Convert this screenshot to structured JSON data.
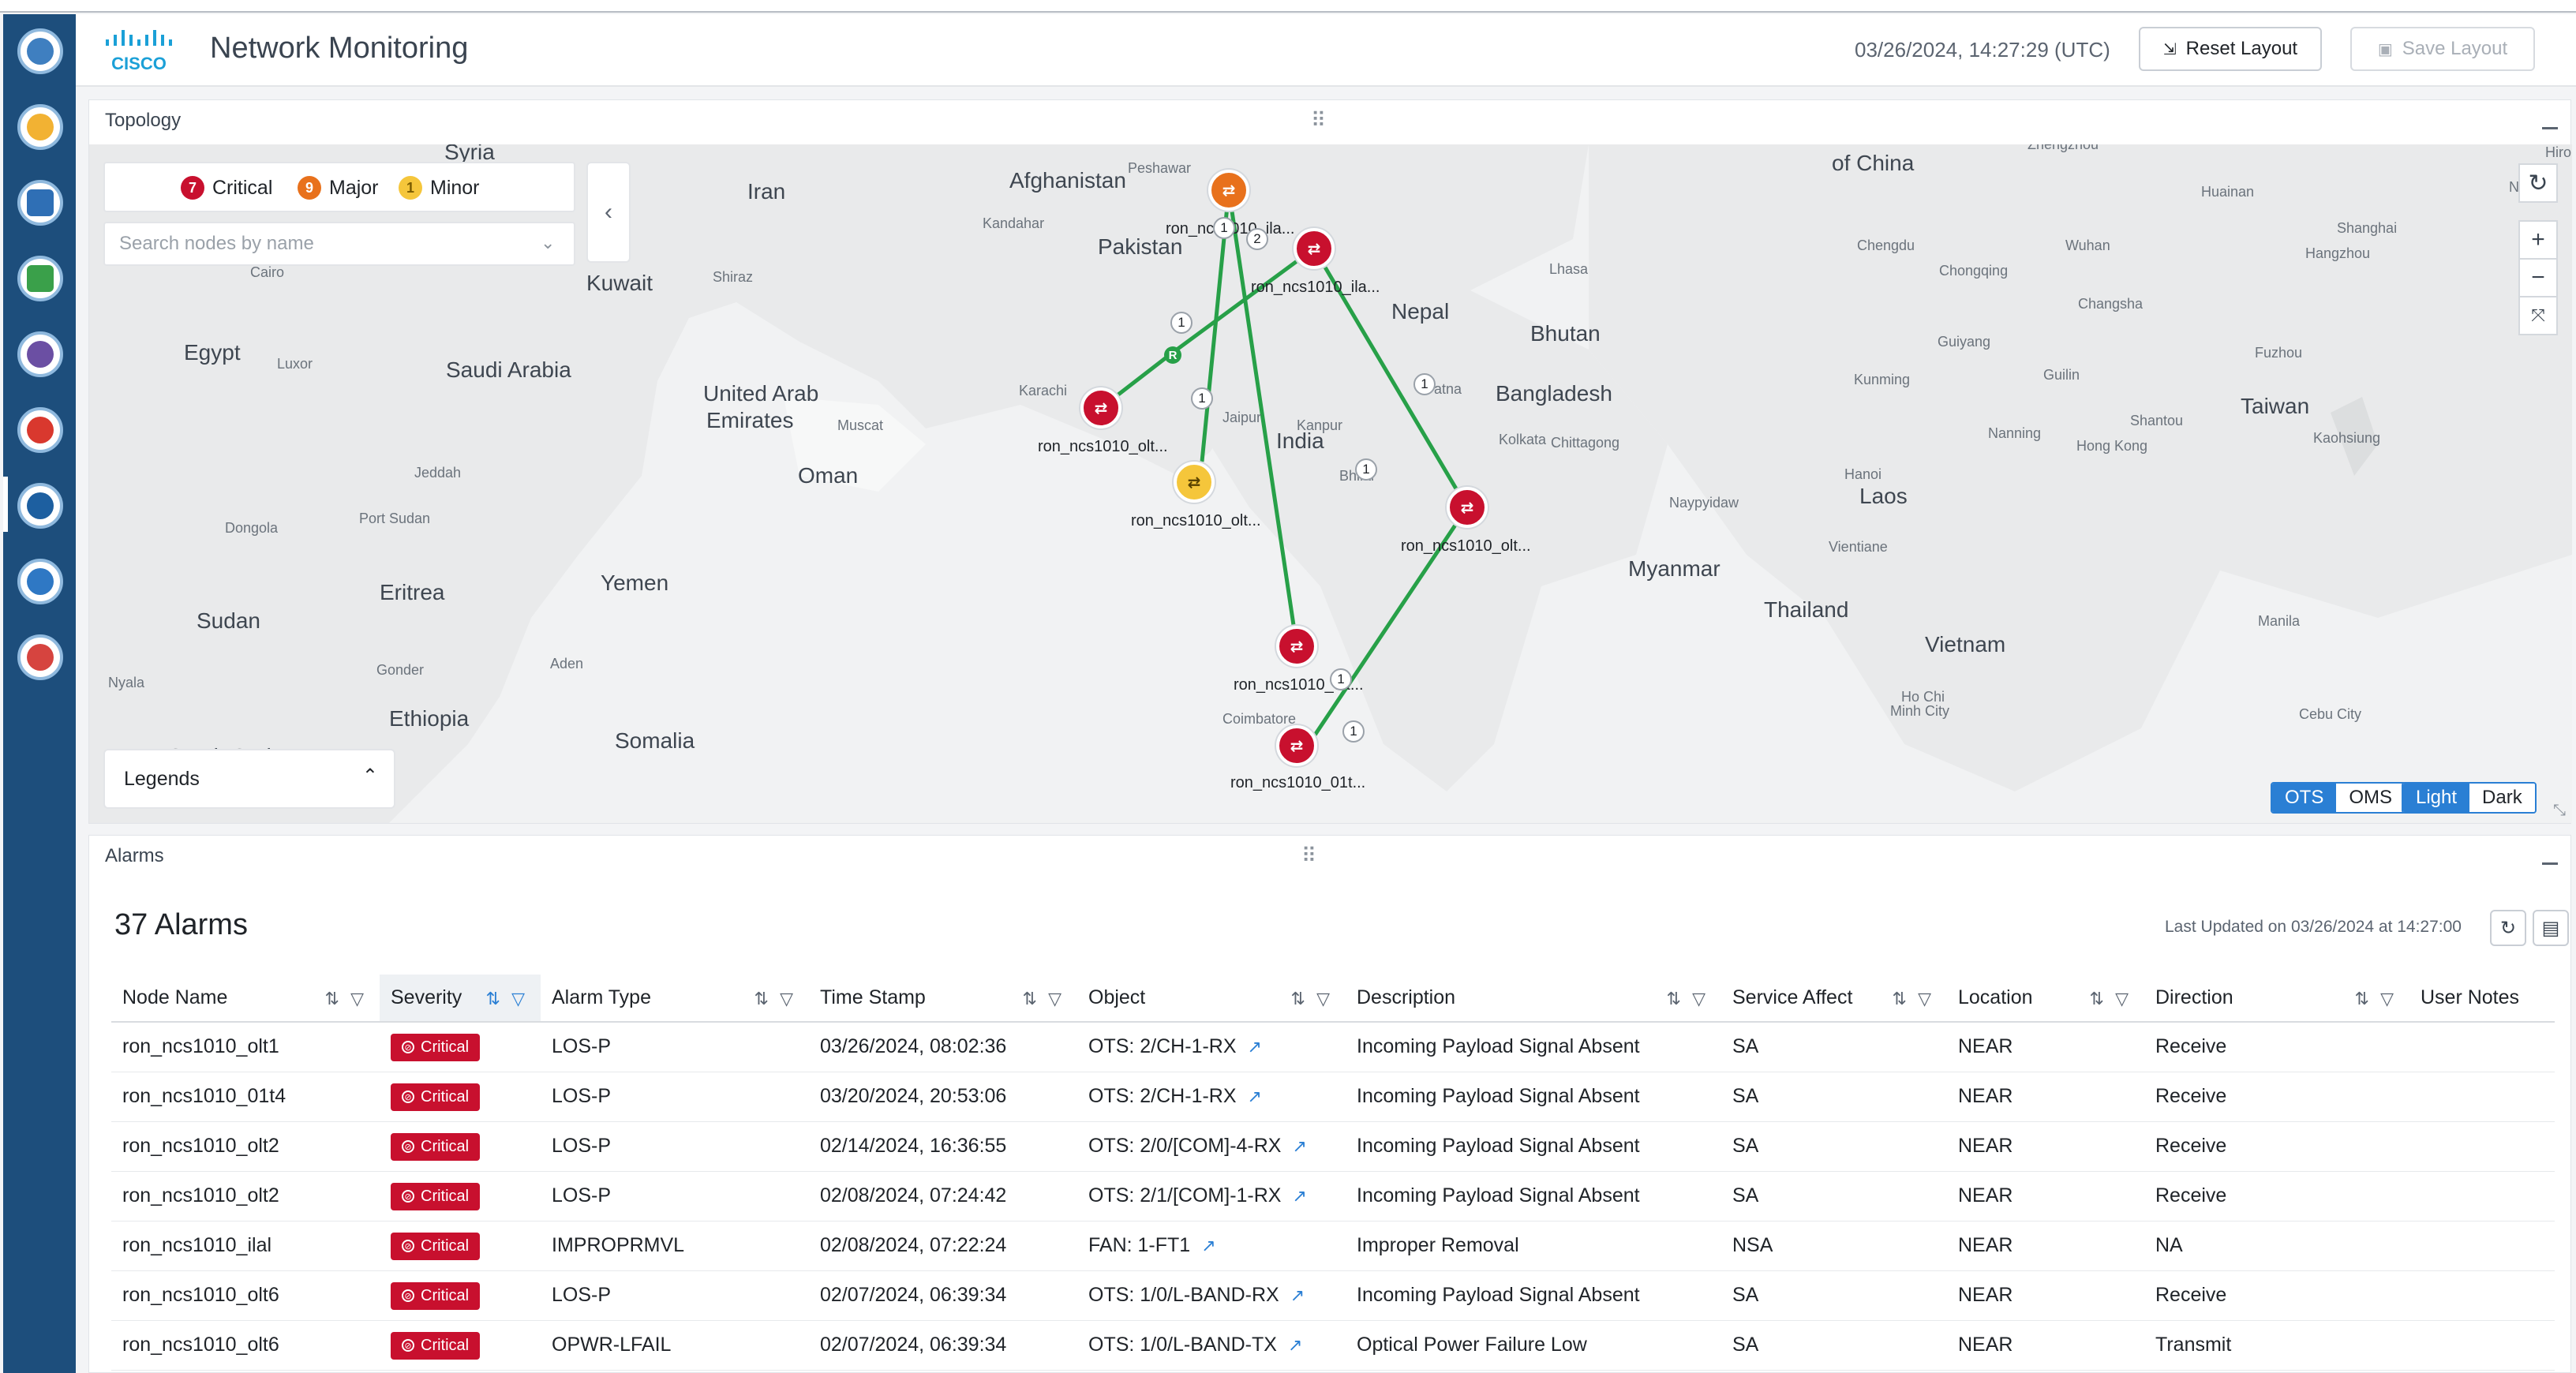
{
  "header": {
    "brand": "CISCO",
    "title": "Network Monitoring",
    "timestamp": "03/26/2024, 14:27:29 (UTC)",
    "reset_layout": "Reset Layout",
    "save_layout": "Save Layout"
  },
  "sidebar": {
    "icons": [
      "dashboard-icon",
      "device-manager-icon",
      "service-icon",
      "inventory-icon",
      "provisioning-icon",
      "alerts-icon",
      "network-monitoring-icon",
      "topology-icon",
      "diagnostics-icon"
    ]
  },
  "topology": {
    "title": "Topology",
    "drag_handle": "⠿",
    "severity": [
      {
        "count": "7",
        "label": "Critical",
        "color": "#c8102e"
      },
      {
        "count": "9",
        "label": "Major",
        "color": "#e8711c"
      },
      {
        "count": "1",
        "label": "Minor",
        "color": "#f5c63b"
      }
    ],
    "search_placeholder": "Search nodes by name",
    "legends": "Legends",
    "link_toggle": {
      "ots": "OTS",
      "oms": "OMS"
    },
    "theme_toggle": {
      "light": "Light",
      "dark": "Dark"
    },
    "map_labels": [
      {
        "text": "Syria",
        "size": 30
      },
      {
        "text": "Iran",
        "size": 30
      },
      {
        "text": "Afghanistan",
        "size": 30
      },
      {
        "text": "Peshawar",
        "size": 20
      },
      {
        "text": "of China",
        "size": 30
      },
      {
        "text": "Kandahar",
        "size": 20
      },
      {
        "text": "Pakistan",
        "size": 30
      },
      {
        "text": "Kuwait",
        "size": 30
      },
      {
        "text": "Shiraz",
        "size": 20
      },
      {
        "text": "Cairo",
        "size": 20
      },
      {
        "text": "Egypt",
        "size": 30
      },
      {
        "text": "Luxor",
        "size": 20
      },
      {
        "text": "Saudi Arabia",
        "size": 30
      },
      {
        "text": "United Arab",
        "size": 30
      },
      {
        "text": "Emirates",
        "size": 30
      },
      {
        "text": "Muscat",
        "size": 20
      },
      {
        "text": "Karachi",
        "size": 20
      },
      {
        "text": "Jaipur",
        "size": 20
      },
      {
        "text": "Kanpur",
        "size": 20
      },
      {
        "text": "Lhasa",
        "size": 20
      },
      {
        "text": "Nepal",
        "size": 30
      },
      {
        "text": "Bhutan",
        "size": 30
      },
      {
        "text": "Patna",
        "size": 20
      },
      {
        "text": "Bangladesh",
        "size": 30
      },
      {
        "text": "Kolkata",
        "size": 20
      },
      {
        "text": "Chittagong",
        "size": 20
      },
      {
        "text": "India",
        "size": 30
      },
      {
        "text": "Bhilai",
        "size": 20
      },
      {
        "text": "Jeddah",
        "size": 20
      },
      {
        "text": "Oman",
        "size": 30
      },
      {
        "text": "Port Sudan",
        "size": 20
      },
      {
        "text": "Dongola",
        "size": 20
      },
      {
        "text": "Yemen",
        "size": 30
      },
      {
        "text": "Eritrea",
        "size": 30
      },
      {
        "text": "Sudan",
        "size": 30
      },
      {
        "text": "Aden",
        "size": 20
      },
      {
        "text": "Gonder",
        "size": 20
      },
      {
        "text": "Nyala",
        "size": 20
      },
      {
        "text": "Ethiopia",
        "size": 30
      },
      {
        "text": "Somalia",
        "size": 30
      },
      {
        "text": "Coimbatore",
        "size": 20
      },
      {
        "text": "Chengdu",
        "size": 20
      },
      {
        "text": "Chongqing",
        "size": 20
      },
      {
        "text": "Wuhan",
        "size": 20
      },
      {
        "text": "Huainan",
        "size": 20
      },
      {
        "text": "Shanghai",
        "size": 20
      },
      {
        "text": "Hangzhou",
        "size": 20
      },
      {
        "text": "Changsha",
        "size": 20
      },
      {
        "text": "Guiyang",
        "size": 20
      },
      {
        "text": "Guilin",
        "size": 20
      },
      {
        "text": "Fuzhou",
        "size": 20
      },
      {
        "text": "Kunming",
        "size": 20
      },
      {
        "text": "Taiwan",
        "size": 30
      },
      {
        "text": "Nanning",
        "size": 20
      },
      {
        "text": "Shantou",
        "size": 20
      },
      {
        "text": "Kaohsiung",
        "size": 20
      },
      {
        "text": "Hong Kong",
        "size": 20
      },
      {
        "text": "Hanoi",
        "size": 20
      },
      {
        "text": "Laos",
        "size": 30
      },
      {
        "text": "Naypyidaw",
        "size": 20
      },
      {
        "text": "Vientiane",
        "size": 20
      },
      {
        "text": "Myanmar",
        "size": 30
      },
      {
        "text": "Thailand",
        "size": 30
      },
      {
        "text": "Vietnam",
        "size": 30
      },
      {
        "text": "Manila",
        "size": 20
      },
      {
        "text": "Ho Chi",
        "size": 20
      },
      {
        "text": "Minh City",
        "size": 20
      },
      {
        "text": "Cebu City",
        "size": 20
      },
      {
        "text": "Hiro",
        "size": 20
      },
      {
        "text": "Naga",
        "size": 20
      },
      {
        "text": "Zhengzhou",
        "size": 20
      },
      {
        "text": "South Sudan",
        "size": 30
      }
    ],
    "nodes": [
      {
        "label": "ron_ncs1010_ila...",
        "severity": "major"
      },
      {
        "label": "ron_ncs1010_ila...",
        "severity": "critical"
      },
      {
        "label": "ron_ncs1010_olt...",
        "severity": "critical"
      },
      {
        "label": "ron_ncs1010_olt...",
        "severity": "minor"
      },
      {
        "label": "ron_ncs1010_olt...",
        "severity": "critical"
      },
      {
        "label": "ron_ncs1010_olt...",
        "severity": "critical"
      },
      {
        "label": "ron_ncs1010_01t...",
        "severity": "critical"
      }
    ],
    "link_badges": [
      "1",
      "2",
      "1",
      "1",
      "1",
      "1",
      "1",
      "1"
    ],
    "link_marker": "R"
  },
  "alarms": {
    "title": "Alarms",
    "count_label": "37 Alarms",
    "last_updated": "Last Updated on 03/26/2024 at 14:27:00",
    "columns": [
      "Node Name",
      "Severity",
      "Alarm Type",
      "Time Stamp",
      "Object",
      "Description",
      "Service Affect",
      "Location",
      "Direction",
      "User Notes"
    ],
    "rows": [
      {
        "node": "ron_ncs1010_olt1",
        "severity": "Critical",
        "type": "LOS-P",
        "time": "03/26/2024, 08:02:36",
        "object": "OTS: 2/CH-1-RX",
        "desc": "Incoming Payload Signal Absent",
        "service": "SA",
        "location": "NEAR",
        "direction": "Receive",
        "notes": ""
      },
      {
        "node": "ron_ncs1010_01t4",
        "severity": "Critical",
        "type": "LOS-P",
        "time": "03/20/2024, 20:53:06",
        "object": "OTS: 2/CH-1-RX",
        "desc": "Incoming Payload Signal Absent",
        "service": "SA",
        "location": "NEAR",
        "direction": "Receive",
        "notes": ""
      },
      {
        "node": "ron_ncs1010_olt2",
        "severity": "Critical",
        "type": "LOS-P",
        "time": "02/14/2024, 16:36:55",
        "object": "OTS: 2/0/[COM]-4-RX",
        "desc": "Incoming Payload Signal Absent",
        "service": "SA",
        "location": "NEAR",
        "direction": "Receive",
        "notes": ""
      },
      {
        "node": "ron_ncs1010_olt2",
        "severity": "Critical",
        "type": "LOS-P",
        "time": "02/08/2024, 07:24:42",
        "object": "OTS: 2/1/[COM]-1-RX",
        "desc": "Incoming Payload Signal Absent",
        "service": "SA",
        "location": "NEAR",
        "direction": "Receive",
        "notes": ""
      },
      {
        "node": "ron_ncs1010_ilal",
        "severity": "Critical",
        "type": "IMPROPRMVL",
        "time": "02/08/2024, 07:22:24",
        "object": "FAN: 1-FT1",
        "desc": "Improper Removal",
        "service": "NSA",
        "location": "NEAR",
        "direction": "NA",
        "notes": ""
      },
      {
        "node": "ron_ncs1010_olt6",
        "severity": "Critical",
        "type": "LOS-P",
        "time": "02/07/2024, 06:39:34",
        "object": "OTS: 1/0/L-BAND-RX",
        "desc": "Incoming Payload Signal Absent",
        "service": "SA",
        "location": "NEAR",
        "direction": "Receive",
        "notes": ""
      },
      {
        "node": "ron_ncs1010_olt6",
        "severity": "Critical",
        "type": "OPWR-LFAIL",
        "time": "02/07/2024, 06:39:34",
        "object": "OTS: 1/0/L-BAND-TX",
        "desc": "Optical Power Failure Low",
        "service": "SA",
        "location": "NEAR",
        "direction": "Transmit",
        "notes": ""
      }
    ]
  }
}
